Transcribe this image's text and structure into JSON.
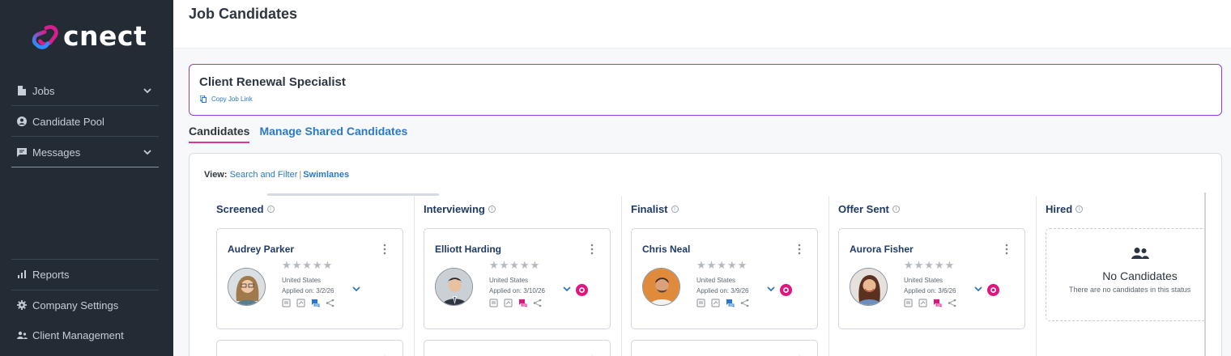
{
  "app": {
    "logo_text": "cnect"
  },
  "sidebar": {
    "items": [
      {
        "label": "Jobs",
        "icon": "file-icon",
        "has_submenu": true
      },
      {
        "label": "Candidate Pool",
        "icon": "user-circle-icon",
        "has_submenu": false
      },
      {
        "label": "Messages",
        "icon": "chat-icon",
        "has_submenu": true
      }
    ],
    "bottom_items": [
      {
        "label": "Reports",
        "icon": "bar-chart-icon"
      },
      {
        "label": "Company Settings",
        "icon": "gear-icon"
      },
      {
        "label": "Client Management",
        "icon": "people-icon"
      }
    ]
  },
  "page": {
    "title": "Job Candidates"
  },
  "job": {
    "title": "Client Renewal Specialist",
    "copy_link_label": "Copy Job Link"
  },
  "tabs": [
    {
      "label": "Candidates",
      "active": true
    },
    {
      "label": "Manage Shared Candidates",
      "active": false
    }
  ],
  "view": {
    "label": "View:",
    "options": [
      "Search and Filter",
      "Swimlanes"
    ],
    "selected": "Swimlanes",
    "separator": "|"
  },
  "lanes": [
    {
      "title": "Screened",
      "candidates": [
        {
          "name": "Audrey Parker",
          "country": "United States",
          "applied": "Applied on: 3/2/26",
          "rating": 0,
          "has_badge": false
        }
      ]
    },
    {
      "title": "Interviewing",
      "candidates": [
        {
          "name": "Elliott Harding",
          "country": "United States",
          "applied": "Applied on: 3/10/26",
          "rating": 0,
          "has_badge": true
        }
      ]
    },
    {
      "title": "Finalist",
      "candidates": [
        {
          "name": "Chris Neal",
          "country": "United States",
          "applied": "Applied on: 3/9/26",
          "rating": 0,
          "has_badge": true
        }
      ]
    },
    {
      "title": "Offer Sent",
      "candidates": [
        {
          "name": "Aurora Fisher",
          "country": "United States",
          "applied": "Applied on: 3/6/26",
          "rating": 0,
          "has_badge": true
        }
      ]
    },
    {
      "title": "Hired",
      "candidates": [],
      "empty_title": "No Candidates",
      "empty_text": "There are no candidates in this status"
    }
  ],
  "stars": "★★★★★",
  "colors": {
    "sidebar_bg": "#232b35",
    "accent_pink": "#e1378f",
    "link_blue": "#2b78c8",
    "job_border": "#8c3fd1",
    "navy": "#1f3a66"
  }
}
